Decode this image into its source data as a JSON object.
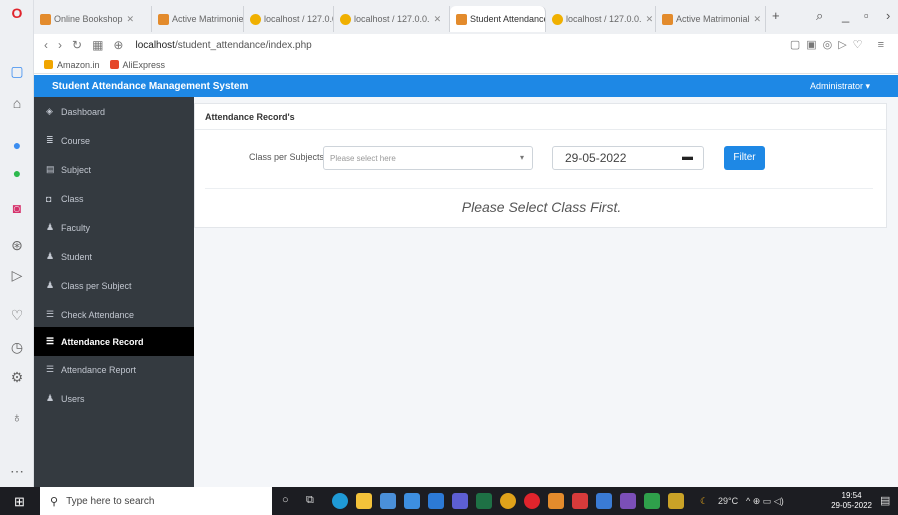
{
  "browser": {
    "tabs": [
      {
        "label": "Online Bookshop",
        "favicon": "orange-square",
        "active": false
      },
      {
        "label": "Active Matrimonie",
        "favicon": "orange-square",
        "active": false
      },
      {
        "label": "localhost / 127.0.0.",
        "favicon": "phpmyadmin-icon",
        "active": false
      },
      {
        "label": "localhost / 127.0.0.",
        "favicon": "phpmyadmin-icon",
        "active": false
      },
      {
        "label": "Student Attendance",
        "favicon": "orange-square",
        "active": true
      },
      {
        "label": "localhost / 127.0.0.",
        "favicon": "phpmyadmin-icon",
        "active": false
      },
      {
        "label": "Active Matrimonial",
        "favicon": "orange-square",
        "active": false
      }
    ],
    "address": {
      "host": "localhost",
      "path": "/student_attendance/index.php"
    },
    "bookmarks": [
      {
        "label": "Amazon.in",
        "color": "#f0a500"
      },
      {
        "label": "AliExpress",
        "color": "#e5482b"
      }
    ]
  },
  "app": {
    "title": "Student Attendance Management System",
    "user": "Administrator",
    "sidebar": [
      {
        "label": "Dashboard",
        "icon": "dashboard-icon",
        "glyph": "◈",
        "active": false
      },
      {
        "label": "Course",
        "icon": "list-icon",
        "glyph": "≣",
        "active": false
      },
      {
        "label": "Subject",
        "icon": "book-icon",
        "glyph": "▤",
        "active": false
      },
      {
        "label": "Class",
        "icon": "class-icon",
        "glyph": "◘",
        "active": false
      },
      {
        "label": "Faculty",
        "icon": "user-icon",
        "glyph": "♟",
        "active": false
      },
      {
        "label": "Student",
        "icon": "users-icon",
        "glyph": "♟",
        "active": false
      },
      {
        "label": "Class per Subject",
        "icon": "users-icon",
        "glyph": "♟",
        "active": false
      },
      {
        "label": "Check Attendance",
        "icon": "list-icon",
        "glyph": "☰",
        "active": false
      },
      {
        "label": "Attendance Record",
        "icon": "list-icon",
        "glyph": "☰",
        "active": true
      },
      {
        "label": "Attendance Report",
        "icon": "list-icon",
        "glyph": "☰",
        "active": false
      },
      {
        "label": "Users",
        "icon": "users-icon",
        "glyph": "♟",
        "active": false
      }
    ],
    "card": {
      "title": "Attendance Record's",
      "filter_label": "Class per Subjects",
      "select_placeholder": "Please select here",
      "date_value": "29-05-2022",
      "filter_button": "Filter",
      "message": "Please Select Class First."
    },
    "accent": "#1e88e5"
  },
  "taskbar": {
    "search_placeholder": "Type here to search",
    "weather": "29°C",
    "time": "19:54",
    "date": "29-05-2022"
  }
}
